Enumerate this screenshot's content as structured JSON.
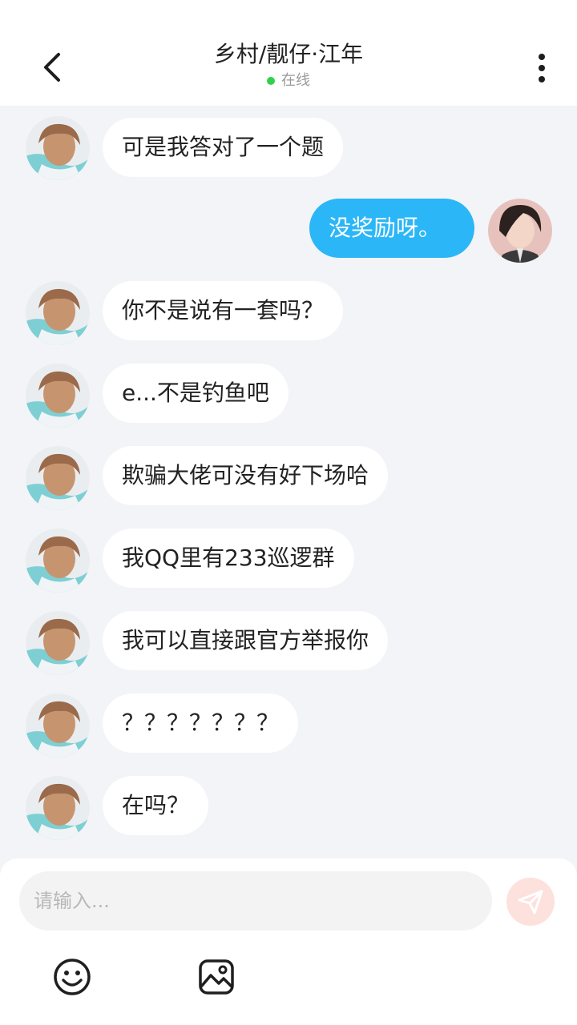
{
  "header": {
    "title": "乡村/靓仔·江年",
    "status": "在线",
    "back_icon": "chevron-left-icon",
    "more_icon": "more-vertical-icon"
  },
  "messages": [
    {
      "from": "other",
      "text": "可是我答对了一个题"
    },
    {
      "from": "me",
      "text": "没奖励呀。"
    },
    {
      "from": "other",
      "text": "你不是说有一套吗？"
    },
    {
      "from": "other",
      "text": "e...不是钓鱼吧"
    },
    {
      "from": "other",
      "text": "欺骗大佬可没有好下场哈"
    },
    {
      "from": "other",
      "text": "我QQ里有233巡逻群"
    },
    {
      "from": "other",
      "text": "我可以直接跟官方举报你"
    },
    {
      "from": "other",
      "text": "？？？？？？？"
    },
    {
      "from": "other",
      "text": "在吗？"
    }
  ],
  "composer": {
    "placeholder": "请输入...",
    "value": "",
    "send_icon": "send-icon",
    "emoji_icon": "smiley-icon",
    "image_icon": "image-icon"
  },
  "colors": {
    "accent": "#2ab6f7",
    "background": "#f3f4f7",
    "online": "#2fd24a",
    "send_disabled": "#fde1dc"
  }
}
